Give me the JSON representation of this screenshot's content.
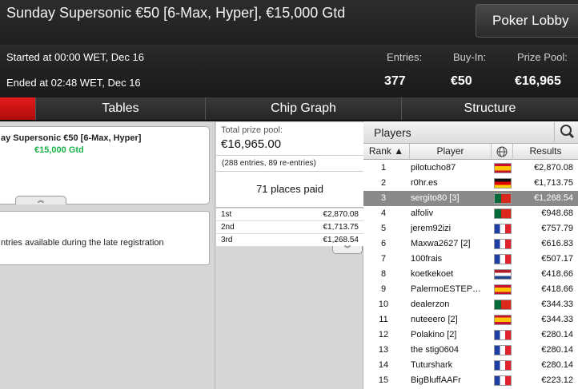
{
  "window": {
    "title": "Sunday Supersonic €50 [6-Max, Hyper], €15,000 Gtd",
    "lobby_button": "Poker Lobby"
  },
  "info": {
    "started": "Started at 00:00 WET, Dec 16",
    "ended": "Ended at 02:48 WET, Dec 16",
    "entries_label": "Entries:",
    "entries_value": "377",
    "buyin_label": "Buy-In:",
    "buyin_value": "€50",
    "prizepool_label": "Prize Pool:",
    "prizepool_value": "€16,965"
  },
  "tabs": [
    {
      "label": ""
    },
    {
      "label": "Tables"
    },
    {
      "label": "Chip Graph"
    },
    {
      "label": "Structure"
    }
  ],
  "left": {
    "card_title": "ay Supersonic €50 [6-Max, Hyper]",
    "card_subtitle": "€15,000 Gtd",
    "expand_glyph": "︽",
    "card2_text": "ntries available during the late registration"
  },
  "prize": {
    "total_label": "Total prize pool:",
    "total_value": "€16,965.00",
    "entries_text": "(288 entries, 89 re-entries)",
    "places_paid": "71 places paid",
    "payouts": [
      {
        "place": "1st",
        "amount": "€2,870.08"
      },
      {
        "place": "2nd",
        "amount": "€1,713.75"
      },
      {
        "place": "3rd",
        "amount": "€1,268.54"
      }
    ],
    "expand_glyph": "︾"
  },
  "players": {
    "title": "Players",
    "col_rank": "Rank ▲",
    "col_player": "Player",
    "col_flag_icon": "globe-icon",
    "col_results": "Results",
    "rows": [
      {
        "rank": "1",
        "name": "pilotucho87",
        "flag": "es",
        "result": "€2,870.08"
      },
      {
        "rank": "2",
        "name": "r0hr.es",
        "flag": "de",
        "result": "€1,713.75"
      },
      {
        "rank": "3",
        "name": "sergito80 [3]",
        "flag": "pt",
        "result": "€1,268.54"
      },
      {
        "rank": "4",
        "name": "alfoliv",
        "flag": "pt",
        "result": "€948.68"
      },
      {
        "rank": "5",
        "name": "jerem92izi",
        "flag": "fr",
        "result": "€757.79"
      },
      {
        "rank": "6",
        "name": "Maxwa2627 [2]",
        "flag": "fr",
        "result": "€616.83"
      },
      {
        "rank": "7",
        "name": "100frais",
        "flag": "fr",
        "result": "€507.17"
      },
      {
        "rank": "8",
        "name": "koetkekoet",
        "flag": "nl",
        "result": "€418.66"
      },
      {
        "rank": "9",
        "name": "PalermoESTEP…",
        "flag": "es",
        "result": "€418.66"
      },
      {
        "rank": "10",
        "name": "dealerzon",
        "flag": "pt",
        "result": "€344.33"
      },
      {
        "rank": "11",
        "name": "nuteeero [2]",
        "flag": "es",
        "result": "€344.33"
      },
      {
        "rank": "12",
        "name": "Polakino [2]",
        "flag": "fr",
        "result": "€280.14"
      },
      {
        "rank": "13",
        "name": "the stig0604",
        "flag": "fr",
        "result": "€280.14"
      },
      {
        "rank": "14",
        "name": "Tuturshark",
        "flag": "fr",
        "result": "€280.14"
      },
      {
        "rank": "15",
        "name": "BigBluffAAFr",
        "flag": "fr",
        "result": "€223.12"
      }
    ],
    "selected_rank": "3"
  }
}
